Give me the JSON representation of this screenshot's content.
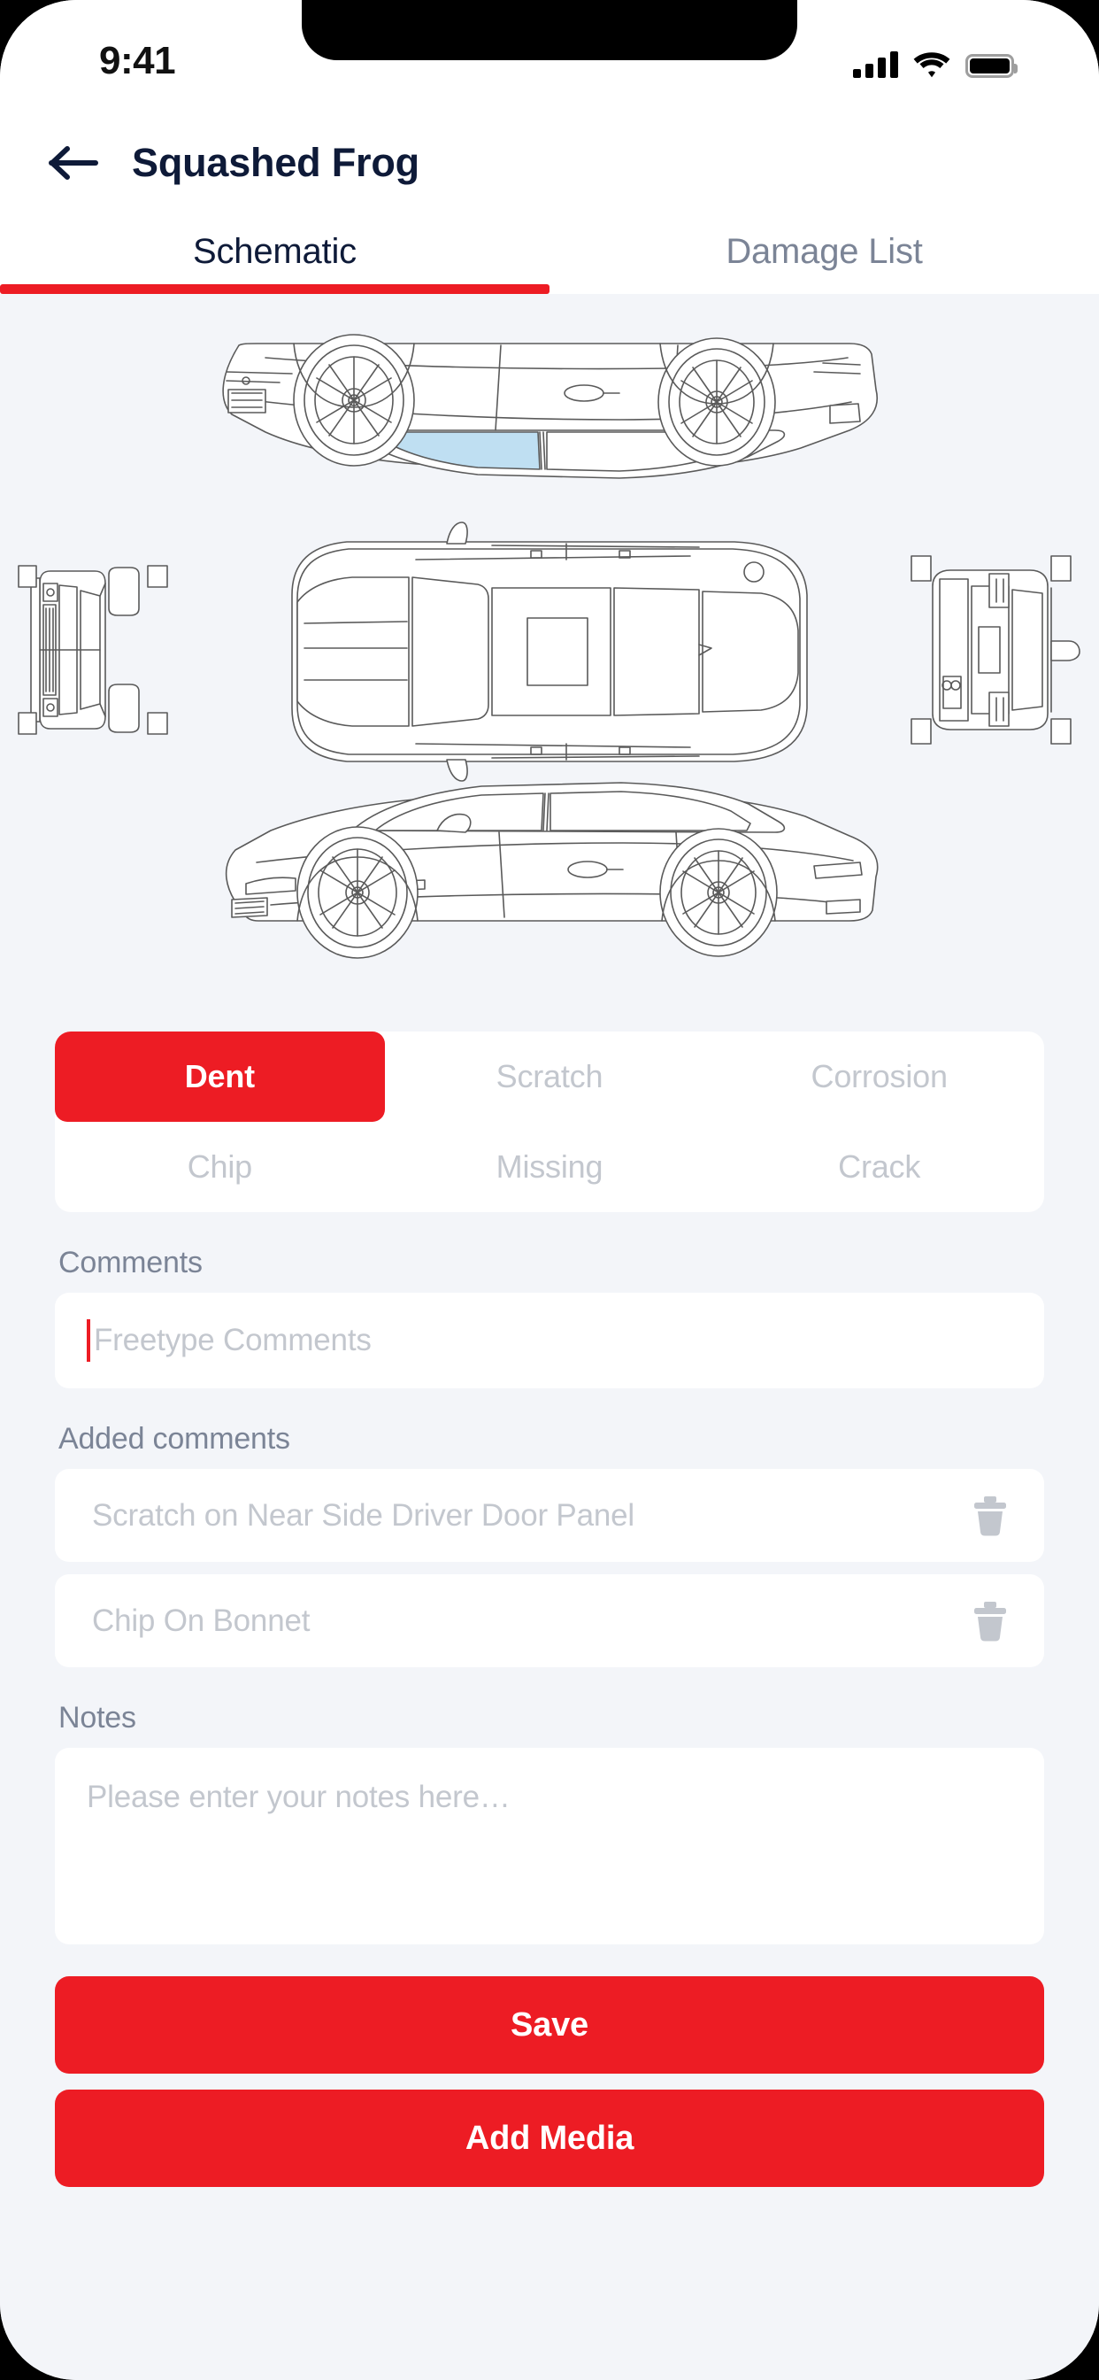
{
  "status_bar": {
    "time": "9:41",
    "signal_icon": "cellular-signal-icon",
    "wifi_icon": "wifi-icon",
    "battery_icon": "battery-full-icon"
  },
  "header": {
    "back_icon": "back-arrow-icon",
    "title": "Squashed Frog"
  },
  "tabs": [
    {
      "label": "Schematic",
      "active": true
    },
    {
      "label": "Damage List",
      "active": false
    }
  ],
  "schematic": {
    "name": "vehicle-damage-schematic",
    "views": [
      "flipped-side-view",
      "front-view",
      "top-view",
      "rear-view",
      "side-view"
    ],
    "highlighted_panel": "near-side-rear-door-window",
    "highlight_color": "#bfdff2",
    "line_color": "#4a4a4a",
    "background_color": "#f3f5f9"
  },
  "damage_types": [
    {
      "label": "Dent",
      "selected": true
    },
    {
      "label": "Scratch",
      "selected": false
    },
    {
      "label": "Corrosion",
      "selected": false
    },
    {
      "label": "Chip",
      "selected": false
    },
    {
      "label": "Missing",
      "selected": false
    },
    {
      "label": "Crack",
      "selected": false
    }
  ],
  "comments": {
    "label": "Comments",
    "value": "",
    "placeholder": "Freetype Comments"
  },
  "added_comments": {
    "label": "Added comments",
    "items": [
      {
        "text": "Scratch on Near Side Driver Door Panel",
        "delete_icon": "trash-icon"
      },
      {
        "text": "Chip On Bonnet",
        "delete_icon": "trash-icon"
      }
    ]
  },
  "notes": {
    "label": "Notes",
    "value": "",
    "placeholder": "Please enter your notes here…"
  },
  "actions": {
    "save_label": "Save",
    "add_media_label": "Add Media"
  },
  "colors": {
    "accent_red": "#ED1C24",
    "title_navy": "#0e1a38",
    "muted_grey": "#7b8496",
    "placeholder_grey": "#c3c7ce",
    "page_background": "#f3f5f9",
    "card_white": "#ffffff"
  }
}
